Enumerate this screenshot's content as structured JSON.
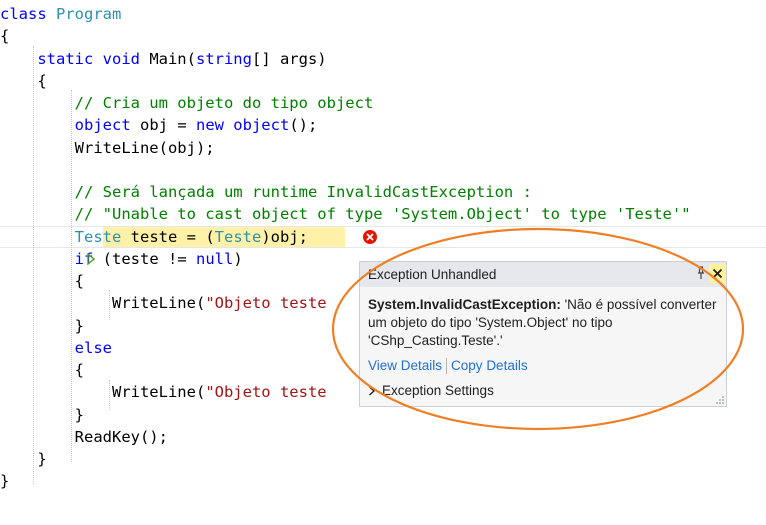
{
  "editor": {
    "lines": [
      {
        "parts": [
          {
            "c": "kw",
            "t": "class "
          },
          {
            "c": "ty",
            "t": "Program"
          }
        ]
      },
      {
        "parts": [
          {
            "c": "",
            "t": "{"
          }
        ]
      },
      {
        "parts": [
          {
            "c": "",
            "t": "    "
          },
          {
            "c": "kw",
            "t": "static void "
          },
          {
            "c": "",
            "t": "Main("
          },
          {
            "c": "kw",
            "t": "string"
          },
          {
            "c": "",
            "t": "[] args)"
          }
        ]
      },
      {
        "parts": [
          {
            "c": "",
            "t": "    {"
          }
        ]
      },
      {
        "parts": [
          {
            "c": "cm",
            "t": "        // Cria um objeto do tipo object"
          }
        ]
      },
      {
        "parts": [
          {
            "c": "",
            "t": "        "
          },
          {
            "c": "kw",
            "t": "object"
          },
          {
            "c": "",
            "t": " obj = "
          },
          {
            "c": "kw",
            "t": "new object"
          },
          {
            "c": "",
            "t": "();"
          }
        ]
      },
      {
        "parts": [
          {
            "c": "",
            "t": "        WriteLine(obj);"
          }
        ]
      },
      {
        "parts": [
          {
            "c": "",
            "t": ""
          }
        ]
      },
      {
        "parts": [
          {
            "c": "cm",
            "t": "        // Será lançada um runtime InvalidCastException :"
          }
        ]
      },
      {
        "parts": [
          {
            "c": "cm",
            "t": "        // \"Unable to cast object of type 'System.Object' to type 'Teste'\""
          }
        ]
      },
      {
        "parts": [
          {
            "c": "",
            "t": "        "
          },
          {
            "c": "ty",
            "t": "Teste"
          },
          {
            "c": "",
            "t": " teste = ("
          },
          {
            "c": "ty",
            "t": "Teste"
          },
          {
            "c": "",
            "t": ")obj;"
          }
        ]
      },
      {
        "parts": [
          {
            "c": "",
            "t": "        "
          },
          {
            "c": "kw",
            "t": "if"
          },
          {
            "c": "",
            "t": " (teste != "
          },
          {
            "c": "kw",
            "t": "null"
          },
          {
            "c": "",
            "t": ")"
          }
        ]
      },
      {
        "parts": [
          {
            "c": "",
            "t": "        {"
          }
        ]
      },
      {
        "parts": [
          {
            "c": "",
            "t": "            WriteLine("
          },
          {
            "c": "st",
            "t": "\"Objeto teste"
          }
        ]
      },
      {
        "parts": [
          {
            "c": "",
            "t": "        }"
          }
        ]
      },
      {
        "parts": [
          {
            "c": "",
            "t": "        "
          },
          {
            "c": "kw",
            "t": "else"
          }
        ]
      },
      {
        "parts": [
          {
            "c": "",
            "t": "        {"
          }
        ]
      },
      {
        "parts": [
          {
            "c": "",
            "t": "            WriteLine("
          },
          {
            "c": "st",
            "t": "\"Objeto teste"
          }
        ]
      },
      {
        "parts": [
          {
            "c": "",
            "t": "        }"
          }
        ]
      },
      {
        "parts": [
          {
            "c": "",
            "t": "        ReadKey();"
          }
        ]
      },
      {
        "parts": [
          {
            "c": "",
            "t": "    }"
          }
        ]
      },
      {
        "parts": [
          {
            "c": "",
            "t": "}"
          }
        ]
      }
    ]
  },
  "exception_popup": {
    "title": "Exception Unhandled",
    "exception_type": "System.InvalidCastException:",
    "message": " 'Não é possível converter um objeto do tipo 'System.Object' no tipo 'CShp_Casting.Teste'.'",
    "view_details": "View Details",
    "copy_details": "Copy Details",
    "settings": "Exception Settings"
  },
  "colors": {
    "keyword": "#0000ff",
    "type": "#2b91af",
    "comment": "#008000",
    "string": "#a31515",
    "highlight": "#fff2a8",
    "annotation_circle": "#f07f24"
  }
}
